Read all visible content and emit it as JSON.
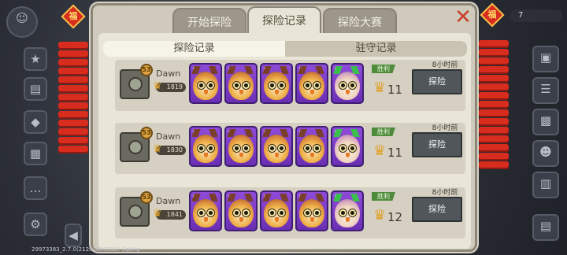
{
  "tabs": [
    "开始探险",
    "探险记录",
    "探险大赛"
  ],
  "sub_tabs": [
    "探险记录",
    "驻守记录"
  ],
  "close_label": "✕",
  "fu_char": "福",
  "top_right_value": "7",
  "records": [
    {
      "player": "Dawn",
      "level": "53",
      "score": "1819",
      "result": "胜利",
      "gain": "11",
      "time": "8小时前",
      "button": "探险",
      "cards": [
        "4",
        "4",
        "4",
        "4",
        "3"
      ]
    },
    {
      "player": "Dawn",
      "level": "53",
      "score": "1830",
      "result": "胜利",
      "gain": "11",
      "time": "8小时前",
      "button": "探险",
      "cards": [
        "4",
        "4",
        "4",
        "4",
        "3"
      ]
    },
    {
      "player": "Dawn",
      "level": "53",
      "score": "1841",
      "result": "胜利",
      "gain": "12",
      "time": "8小时前",
      "button": "探险",
      "cards": [
        "4",
        "4",
        "4",
        "4",
        "3"
      ]
    }
  ],
  "footer": "29973383_2.7.0(21200000632)_1g0Hp",
  "colors": {
    "panel": "#cfcabb",
    "card_purple": "#7a3bd0",
    "button": "#505659",
    "win_green": "#4e8c3b"
  }
}
